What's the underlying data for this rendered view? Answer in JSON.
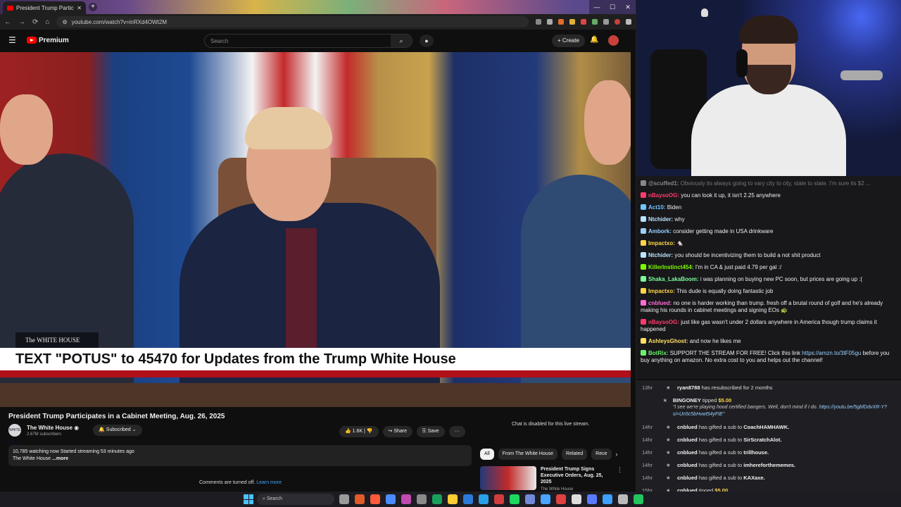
{
  "browser": {
    "tab_title": "President Trump Participa",
    "new_tab_glyph": "+",
    "window_controls": [
      "—",
      "☐",
      "✕"
    ],
    "nav_buttons": [
      "←",
      "→",
      "⟳",
      "⌂"
    ],
    "url": "youtube.com/watch?v=inRXd4OWt2M"
  },
  "youtube": {
    "brand": "Premium",
    "search_placeholder": "Search",
    "create_label": "+ Create"
  },
  "video": {
    "chyron_logo": "The WHITE HOUSE",
    "chyron_text": "TEXT \"POTUS\" to 45470 for Updates from the Trump White House",
    "title": "President Trump Participates in a Cabinet Meeting, Aug. 26, 2025",
    "channel_name": "The White House",
    "channel_avatar_text": "WHITE HOUSE",
    "subscribers": "2.67M subscribers",
    "subscribed_label": "Subscribed",
    "likes": "1.6K",
    "share_label": "Share",
    "save_label": "Save",
    "description_line1": "10,785 watching now  Started streaming 53 minutes ago",
    "description_line2": "The White House",
    "description_more": "...more",
    "comments_off": "Comments are turned off.",
    "learn_more": "Learn more",
    "chat_disabled": "Chat is disabled for this live stream."
  },
  "side": {
    "chips": [
      "All",
      "From The White House",
      "Related",
      "Rece"
    ],
    "rec_title": "President Trump Signs Executive Orders, Aug. 25, 2025",
    "rec_channel": "The White House"
  },
  "chat": {
    "messages": [
      {
        "user": "@scuffed1:",
        "text": "Obviously its always going to vary city to city, state to state. I'm sure its $2 ...",
        "color": "#888888",
        "faded": true
      },
      {
        "user": "nBaysoOG:",
        "text": "you can look it up, it isn't 2.25 anywhere",
        "color": "#ff3b6b"
      },
      {
        "user": "Act10:",
        "text": "Biden",
        "color": "#6ec6ff"
      },
      {
        "user": "Ntchider:",
        "text": "why",
        "color": "#b9e3ff"
      },
      {
        "user": "Ambork:",
        "text": "consider getting made in USA drinkware",
        "color": "#9ad1ff"
      },
      {
        "user": "Impactxo:",
        "text": "🐁",
        "color": "#ffd54a"
      },
      {
        "user": "Ntchider:",
        "text": "you should be incentivizing them to build a not shit product",
        "color": "#b9e3ff"
      },
      {
        "user": "KillerInstinct454:",
        "text": "I'm in CA & just paid 4.79 per gal :/",
        "color": "#7cfc00"
      },
      {
        "user": "Shaka_LakaBoom:",
        "text": "i was planning on buying new PC soon, but prices are going up :(",
        "color": "#7cfc9a"
      },
      {
        "user": "Impactxo:",
        "text": "This dude is equally doing fantastic job",
        "color": "#ffd54a"
      },
      {
        "user": "cnblued:",
        "text": "no one is harder working than trump. fresh off a brutal round of golf and he's already making his rounds in cabinet meetings and signing EOs 🐢",
        "color": "#ff6bd6"
      },
      {
        "user": "nBaysoOG:",
        "text": "just like gas wasn't under 2 dollars anywhere in America though trump claims it happened",
        "color": "#ff3b6b"
      },
      {
        "user": "AshleysGhost:",
        "text": "and now he likes me",
        "color": "#ffe066"
      },
      {
        "user": "BotRix:",
        "text": "SUPPORT THE STREAM FOR FREE! Click this link",
        "link": "https://amzn.to/3tF05gu",
        "text2": "before you buy anything on amazon. No extra cost to you and helps out the channel!",
        "color": "#6cf26c"
      }
    ]
  },
  "feed": {
    "rows": [
      {
        "time": "13hr",
        "icon": "★",
        "user": "ryan8788",
        "text": " has resubscribed for 2 months"
      },
      {
        "time": "",
        "icon": "★",
        "user": "BINGONEY",
        "text": " tipped ",
        "amount": "$5.00",
        "quote": "\"I see we're playing hood certified bangers. Well, don't mind if I do.",
        "quote_link": "https://youtu.be/5gbfDdvXR-Y?si=Un5c5bHvwt54yFtE",
        "quote_end": "\""
      },
      {
        "time": "14hr",
        "icon": "★",
        "user": "cnblued",
        "text": " has gifted a sub to ",
        "target": "CoachHAMHAWK."
      },
      {
        "time": "14hr",
        "icon": "★",
        "user": "cnblued",
        "text": " has gifted a sub to ",
        "target": "SirScratchAlot."
      },
      {
        "time": "14hr",
        "icon": "★",
        "user": "cnblued",
        "text": " has gifted a sub to ",
        "target": "trillhouse."
      },
      {
        "time": "14hr",
        "icon": "★",
        "user": "cnblued",
        "text": " has gifted a sub to ",
        "target": "imhereforthememes."
      },
      {
        "time": "14hr",
        "icon": "★",
        "user": "cnblued",
        "text": " has gifted a sub to ",
        "target": "KAXaxe."
      },
      {
        "time": "15hr",
        "icon": "★",
        "user": "cnblued",
        "text": " tipped ",
        "amount": "$5.00"
      }
    ]
  },
  "taskbar": {
    "search_label": "Search",
    "icon_colors": [
      "#9a9a9a",
      "#e05a2a",
      "#ff5a3c",
      "#4a8cff",
      "#c04ab0",
      "#8a8a8a",
      "#1a9f5a",
      "#ffcc33",
      "#2a7bd8",
      "#2aa0e8",
      "#d23c3c",
      "#1ed760",
      "#7289da",
      "#4aa3ff",
      "#e04040",
      "#dddddd",
      "#5a7aff",
      "#3ea0ff",
      "#bbbbbb",
      "#22c55e"
    ]
  }
}
